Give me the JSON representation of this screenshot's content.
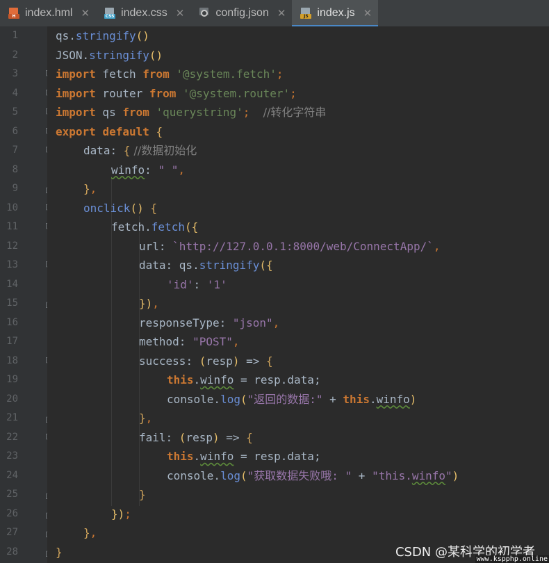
{
  "tabs": [
    {
      "label": "index.hml",
      "icon": "hml-file-icon",
      "active": false
    },
    {
      "label": "index.css",
      "icon": "css-file-icon",
      "active": false
    },
    {
      "label": "config.json",
      "icon": "json-config-file-icon",
      "active": false
    },
    {
      "label": "index.js",
      "icon": "js-file-icon",
      "active": true
    }
  ],
  "colors": {
    "background": "#2b2b2b",
    "gutter": "#313335",
    "keyword": "#cc7832",
    "string": "#6a8759",
    "function": "#ffc66d",
    "accent": "#4a88c7"
  },
  "code": {
    "l1": {
      "a": "qs.",
      "b": "stringify",
      "c": "()"
    },
    "l2": {
      "a": "JSON.",
      "b": "stringify",
      "c": "()"
    },
    "l3": {
      "kw1": "import",
      "a": " fetch ",
      "kw2": "from",
      "sp": " ",
      "s": "'@system.fetch'",
      "e": ";"
    },
    "l4": {
      "kw1": "import",
      "a": " router ",
      "kw2": "from",
      "sp": " ",
      "s": "'@system.router'",
      "e": ";"
    },
    "l5": {
      "kw1": "import",
      "a": " qs ",
      "kw2": "from",
      "sp": " ",
      "s": "'querystring'",
      "e": ";  ",
      "c": "//转化字符串"
    },
    "l6": {
      "kw1": "export",
      "sp": " ",
      "kw2": "default",
      "b": " {"
    },
    "l7": {
      "a": "data",
      "b": ": ",
      "c": "{",
      "d": " //数据初始化"
    },
    "l8": {
      "a": "winfo",
      "b": ": ",
      "s": "\" \"",
      "e": ","
    },
    "l9": {
      "a": "}",
      "b": ","
    },
    "l10": {
      "a": "onclick",
      "b": "()",
      "c": " {"
    },
    "l11": {
      "a": "fetch.",
      "b": "fetch",
      "c": "({"
    },
    "l12": {
      "a": "url",
      "b": ": ",
      "s": "`http://127.0.0.1:8000/web/ConnectApp/`",
      "e": ","
    },
    "l13": {
      "a": "data",
      "b": ": qs.",
      "c": "stringify",
      "d": "({"
    },
    "l14": {
      "s1": "'id'",
      "b": ": ",
      "s2": "'1'"
    },
    "l15": {
      "a": "})",
      "b": ","
    },
    "l16": {
      "a": "responseType",
      "b": ": ",
      "s": "\"json\"",
      "e": ","
    },
    "l17": {
      "a": "method",
      "b": ": ",
      "s": "\"POST\"",
      "e": ","
    },
    "l18": {
      "a": "success",
      "b": ": ",
      "c": "(",
      "d": "resp",
      "e": ")",
      "f": " => ",
      "g": "{"
    },
    "l19": {
      "t": "this",
      "a": ".",
      "w": "winfo",
      "b": " = resp.data;"
    },
    "l20": {
      "a": "console.",
      "b": "log",
      "c": "(",
      "s": "\"返回的数据:\"",
      "d": " + ",
      "t": "this",
      "e": ".",
      "w": "winfo",
      "f": ")"
    },
    "l21": {
      "a": "}",
      "b": ","
    },
    "l22": {
      "a": "fail",
      "b": ": ",
      "c": "(",
      "d": "resp",
      "e": ")",
      "f": " => ",
      "g": "{"
    },
    "l23": {
      "t": "this",
      "a": ".",
      "w": "winfo",
      "b": " = resp.data;"
    },
    "l24": {
      "a": "console.",
      "b": "log",
      "c": "(",
      "s1": "\"获取数据失败哦: \"",
      "d": " + ",
      "s2a": "\"this.",
      "s2w": "winfo",
      "s2b": "\"",
      "f": ")"
    },
    "l25": {
      "a": "}"
    },
    "l26": {
      "a": "})",
      "b": ";"
    },
    "l27": {
      "a": "}",
      "b": ","
    },
    "l28": {
      "a": "}"
    }
  },
  "line_numbers": [
    "1",
    "2",
    "3",
    "4",
    "5",
    "6",
    "7",
    "8",
    "9",
    "10",
    "11",
    "12",
    "13",
    "14",
    "15",
    "16",
    "17",
    "18",
    "19",
    "20",
    "21",
    "22",
    "23",
    "24",
    "25",
    "26",
    "27",
    "28"
  ],
  "watermark": "CSDN @某科学的初学者",
  "watermark2": "www.kspphp.online"
}
